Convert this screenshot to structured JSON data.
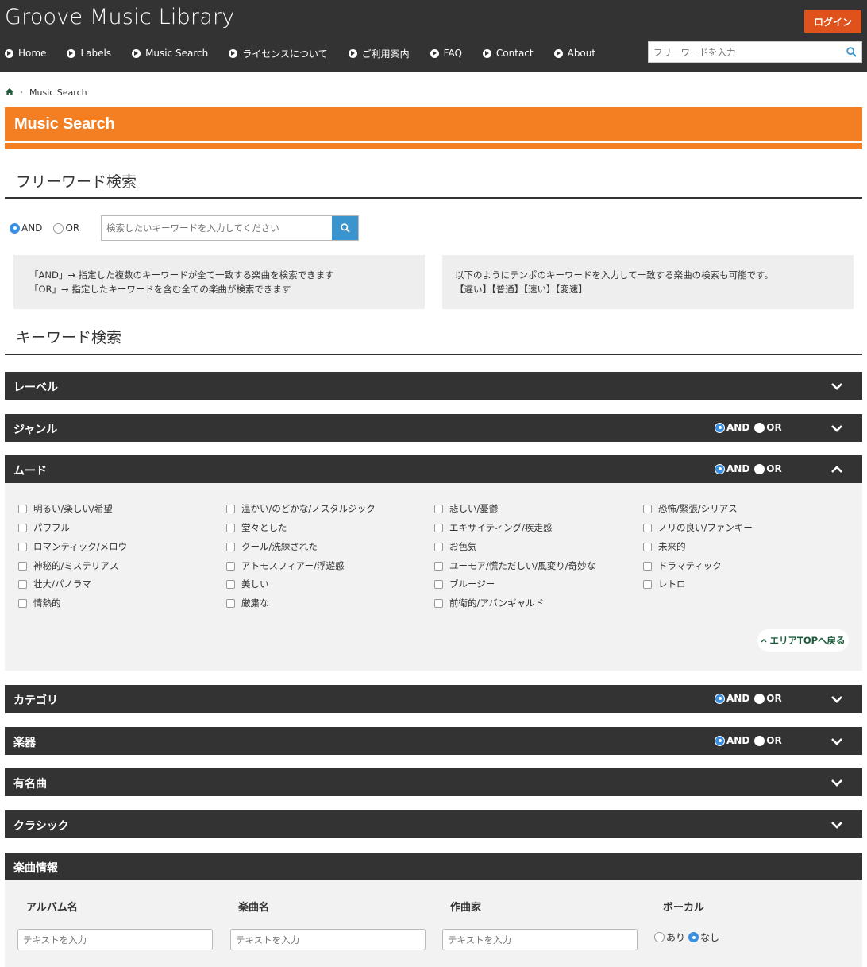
{
  "header": {
    "site_title": "Groove Music Library",
    "login_label": "ログイン",
    "search_placeholder": "フリーワードを入力",
    "nav": [
      "Home",
      "Labels",
      "Music Search",
      "ライセンスについて",
      "ご利用案内",
      "FAQ",
      "Contact",
      "About"
    ]
  },
  "breadcrumb": {
    "current": "Music Search"
  },
  "page_title": "Music Search",
  "free_word": {
    "heading": "フリーワード検索",
    "and_label": "AND",
    "or_label": "OR",
    "placeholder": "検索したいキーワードを入力してください",
    "info_left": [
      "「AND」→ 指定した複数のキーワードが全て一致する楽曲を検索できます",
      "「OR」→ 指定したキーワードを含む全ての楽曲が検索できます"
    ],
    "info_right": [
      "以下のようにテンポのキーワードを入力して一致する楽曲の検索も可能です。",
      "【遅い】【普通】【速い】【変速】"
    ]
  },
  "keyword": {
    "heading": "キーワード検索",
    "and_label": "AND",
    "or_label": "OR",
    "sections": {
      "label": "レーベル",
      "genre": "ジャンル",
      "mood": "ムード",
      "category": "カテゴリ",
      "instrument": "楽器",
      "famous": "有名曲",
      "classic": "クラシック",
      "song_info": "楽曲情報"
    },
    "mood_items": [
      [
        "明るい/楽しい/希望",
        "パワフル",
        "ロマンティック/メロウ",
        "神秘的/ミステリアス",
        "壮大/パノラマ",
        "情熱的"
      ],
      [
        "温かい/のどかな/ノスタルジック",
        "堂々とした",
        "クール/洗練された",
        "アトモスフィアー/浮遊感",
        "美しい",
        "厳粛な"
      ],
      [
        "悲しい/憂鬱",
        "エキサイティング/疾走感",
        "お色気",
        "ユーモア/慌ただしい/風変り/奇妙な",
        "ブルージー",
        "前衛的/アバンギャルド"
      ],
      [
        "恐怖/緊張/シリアス",
        "ノリの良い/ファンキー",
        "未来的",
        "ドラマティック",
        "レトロ"
      ]
    ],
    "area_top": "エリアTOPへ戻る"
  },
  "song_info": {
    "album_label": "アルバム名",
    "title_label": "楽曲名",
    "composer_label": "作曲家",
    "vocal_label": "ボーカル",
    "input_placeholder": "テキストを入力",
    "vocal_yes": "あり",
    "vocal_no": "なし"
  },
  "colors": {
    "header_bg": "#333333",
    "accent": "#f47f22",
    "login": "#e0521c",
    "search_btn": "#3a95cf",
    "radio_on": "#3b8fe0"
  }
}
